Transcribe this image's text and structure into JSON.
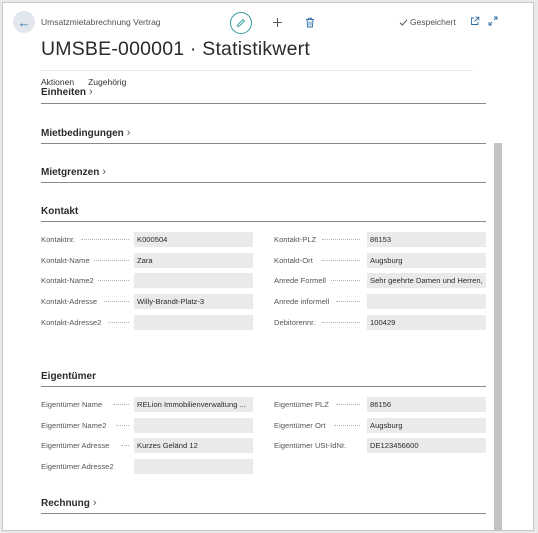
{
  "header": {
    "breadcrumb": "Umsatzmietabrechnung Vertrag",
    "title": "UMSBE-000001 · Statistikwert",
    "saved_label": "Gespeichert"
  },
  "actions": [
    "Aktionen",
    "Zugehörig"
  ],
  "sections": {
    "einheiten": "Einheiten",
    "mietbedingungen": "Mietbedingungen",
    "mietgrenzen": "Mietgrenzen",
    "kontakt": "Kontakt",
    "eigentuemer": "Eigentümer",
    "rechnung": "Rechnung"
  },
  "kontakt": {
    "left": [
      {
        "label": "Kontaktnr.",
        "value": "K000504"
      },
      {
        "label": "Kontakt-Name",
        "value": "Zara"
      },
      {
        "label": "Kontakt-Name2",
        "value": ""
      },
      {
        "label": "Kontakt-Adresse",
        "value": "Willy-Brandt-Platz-3"
      },
      {
        "label": "Kontakt-Adresse2",
        "value": ""
      }
    ],
    "right": [
      {
        "label": "Kontakt-PLZ",
        "value": "86153"
      },
      {
        "label": "Kontakt-Ort",
        "value": "Augsburg"
      },
      {
        "label": "Anrede Formell",
        "value": "Sehr geehrte Damen und Herren,"
      },
      {
        "label": "Anrede informell",
        "value": ""
      },
      {
        "label": "Debitorennr.",
        "value": "100429"
      }
    ]
  },
  "eigentuemer": {
    "left": [
      {
        "label": "Eigentümer Name",
        "value": "RELion Immobilienverwaltung ..."
      },
      {
        "label": "Eigentümer Name2",
        "value": ""
      },
      {
        "label": "Eigentümer Adresse",
        "value": "Kurzes Geländ 12"
      },
      {
        "label": "Eigentümer Adresse2",
        "value": ""
      }
    ],
    "right": [
      {
        "label": "Eigentümer PLZ",
        "value": "86156"
      },
      {
        "label": "Eigentümer Ort",
        "value": "Augsburg"
      },
      {
        "label": "Eigentümer USt-IdNr.",
        "value": "DE123456600"
      }
    ]
  },
  "icons": {
    "back": "arrow-left-icon",
    "edit": "pencil-icon",
    "new": "plus-icon",
    "delete": "trash-icon",
    "saved": "checkmark-icon",
    "open_new": "open-in-new-window-icon",
    "expand": "expand-icon"
  },
  "colors": {
    "accent": "#2e9b9b",
    "link": "#2e6da4",
    "field_bg": "#eaeaea"
  }
}
